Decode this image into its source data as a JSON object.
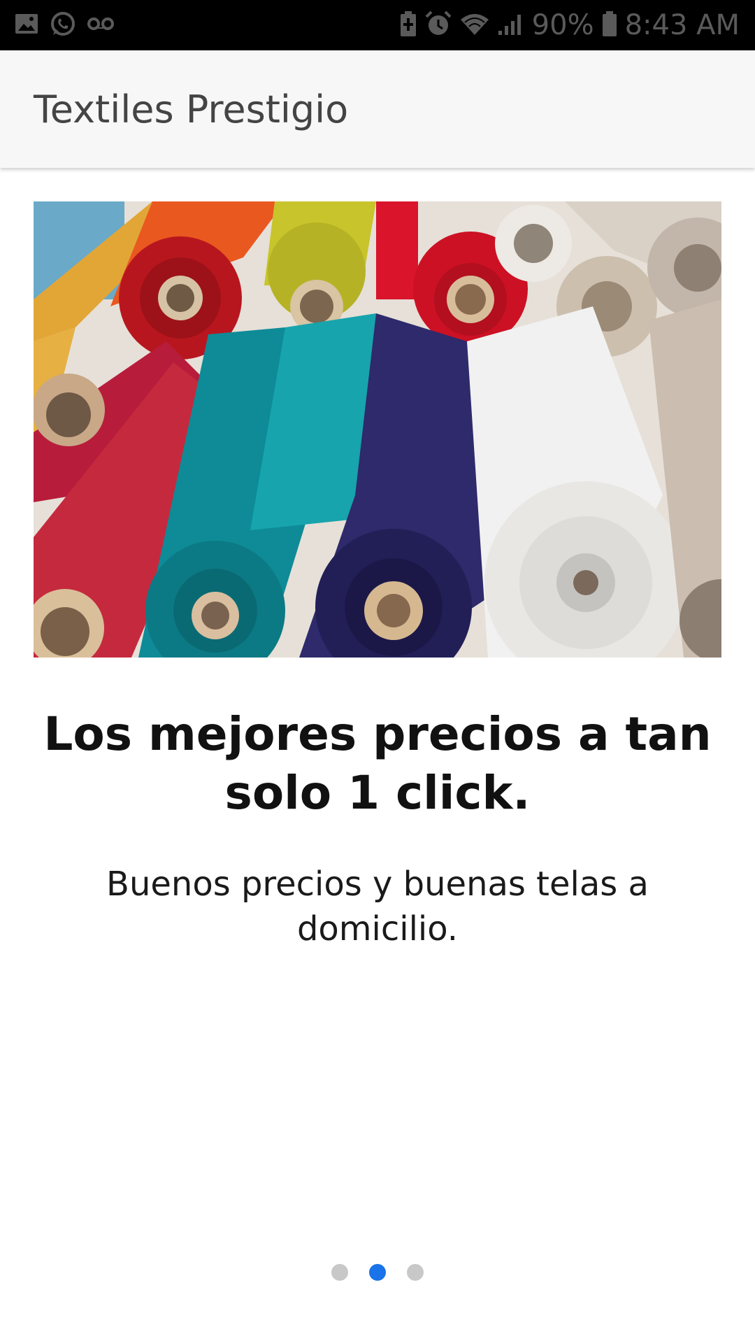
{
  "status_bar": {
    "left_icons": [
      "image-icon",
      "whatsapp-icon",
      "voicemail-icon"
    ],
    "right_icons": [
      "battery-saver-icon",
      "alarm-icon",
      "wifi-icon",
      "signal-icon",
      "battery-icon"
    ],
    "battery": "90%",
    "time": "8:43 AM"
  },
  "app_bar": {
    "title": "Textiles Prestigio"
  },
  "hero": {
    "image_name": "fabric-rolls-image"
  },
  "slide": {
    "headline": "Los mejores precios a tan solo 1 click.",
    "subtext": "Buenos precios y buenas telas a domicilio."
  },
  "pager": {
    "total": 3,
    "active_index": 1,
    "active_color": "#1a73e8",
    "inactive_color": "#c8c8c8"
  }
}
